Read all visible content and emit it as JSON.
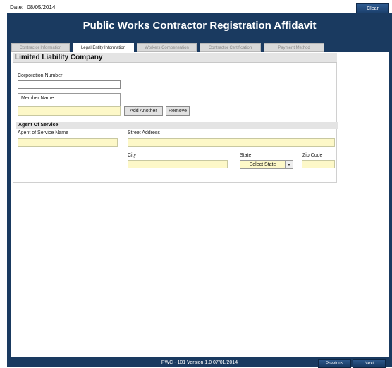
{
  "header": {
    "date_label": "Date:",
    "date_value": "08/05/2014",
    "clear_label": "Clear"
  },
  "title": "Public Works Contractor Registration Affidavit",
  "tabs": [
    {
      "label": "Contractor Information",
      "active": false
    },
    {
      "label": "Legal Entity Information",
      "active": true
    },
    {
      "label": "Workers Compensation",
      "active": false
    },
    {
      "label": "Contractor Certification",
      "active": false
    },
    {
      "label": "Payment Method",
      "active": false
    }
  ],
  "section": {
    "title": "Limited Liability Company",
    "corporation_number_label": "Corporation Number",
    "corporation_number_value": "",
    "member_name_label": "Member Name",
    "member_name_value": "",
    "add_another_label": "Add Another",
    "remove_label": "Remove"
  },
  "agent": {
    "heading": "Agent Of Service",
    "name_label": "Agent of Service Name",
    "name_value": "",
    "street_label": "Street Address",
    "street_value": "",
    "city_label": "City",
    "city_value": "",
    "state_label": "State:",
    "state_selected": "Select State",
    "zip_label": "Zip Code",
    "zip_value": ""
  },
  "footer": {
    "version": "PWC - 101 Version 1.0 07/01/2014",
    "previous_label": "Previous",
    "next_label": "Next"
  },
  "colors": {
    "frame": "#1a3a60",
    "required_field": "#fdf8c8",
    "button_blue": "#1b3f6b"
  }
}
